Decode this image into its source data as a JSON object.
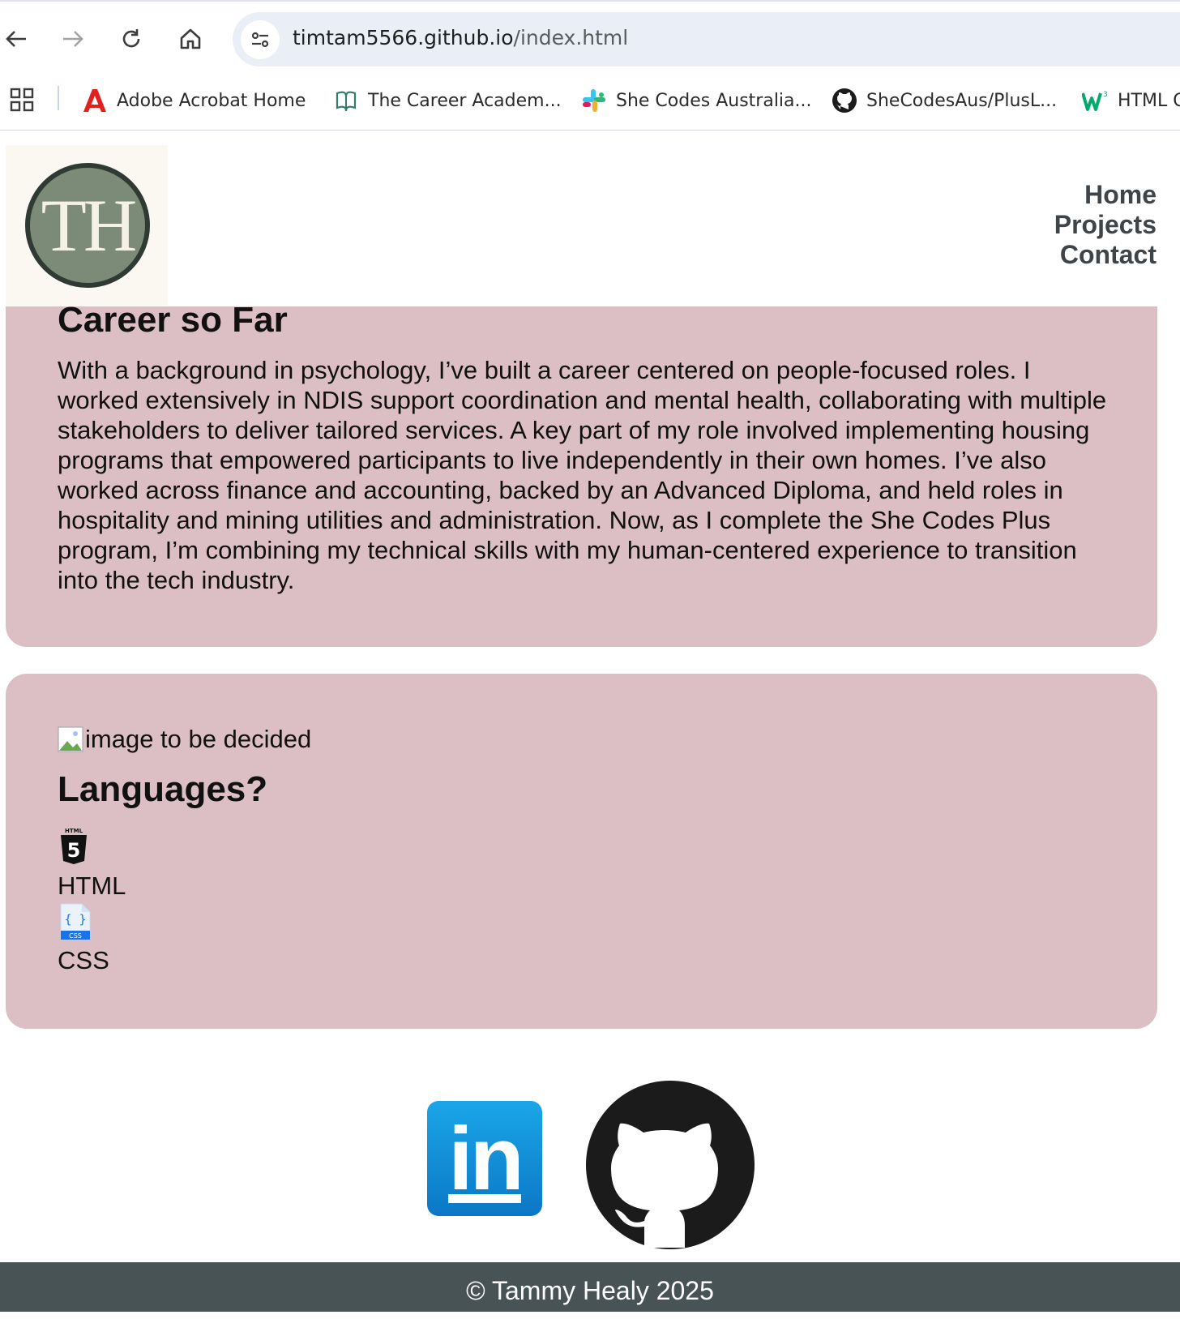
{
  "browser": {
    "url_host": "timtam5566.github.io",
    "url_path": "/index.html",
    "bookmarks": [
      {
        "label": "Adobe Acrobat Home",
        "icon": "adobe-acrobat-icon"
      },
      {
        "label": "The Career Academ...",
        "icon": "career-academy-icon"
      },
      {
        "label": "She Codes Australia...",
        "icon": "slack-icon"
      },
      {
        "label": "SheCodesAus/PlusL...",
        "icon": "github-icon"
      },
      {
        "label": "HTML C",
        "icon": "w3schools-icon"
      }
    ]
  },
  "header": {
    "logo_text": "TH",
    "nav": [
      "Home",
      "Projects",
      "Contact"
    ]
  },
  "career": {
    "title": "Career so Far",
    "body": "With a background in psychology, I’ve built a career centered on people-focused roles. I worked extensively in NDIS support coordination and mental health, collaborating with multiple stakeholders to deliver tailored services. A key part of my role involved implementing housing programs that empowered participants to live independently in their own homes. I’ve also worked across finance and accounting, backed by an Advanced Diploma, and held roles in hospitality and mining utilities and administration. Now, as I complete the She Codes Plus program, I’m combining my technical skills with my human-centered experience to transition into the tech industry."
  },
  "languages": {
    "image_alt": "image to be decided",
    "title": "Languages?",
    "items": [
      {
        "label": "HTML",
        "icon": "html5-icon",
        "badge": "HTML",
        "glyph": "5"
      },
      {
        "label": "CSS",
        "icon": "css-file-icon",
        "badge": "CSS",
        "glyph": "{ }"
      }
    ]
  },
  "social": {
    "linkedin_text": "in",
    "links": [
      "linkedin-icon",
      "github-icon"
    ]
  },
  "footer": {
    "text": "© Tammy Healy 2025"
  }
}
